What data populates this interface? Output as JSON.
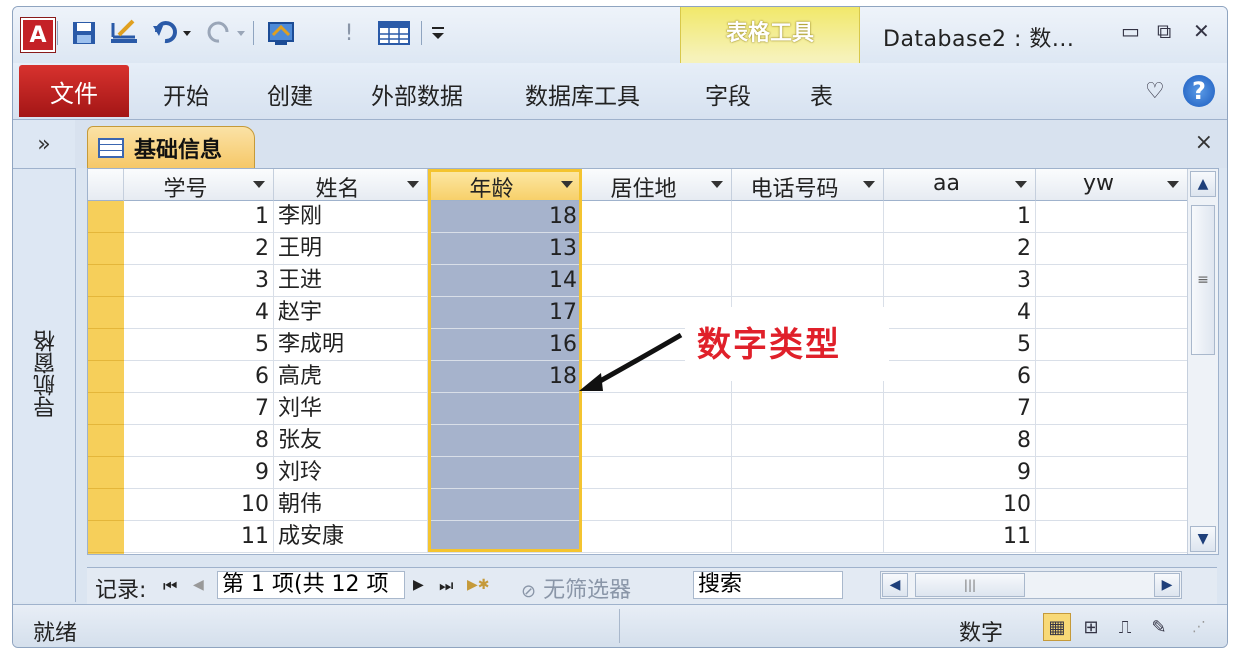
{
  "titlebar": {
    "app_logo": "A",
    "qa_icons": [
      "save-icon",
      "design-icon",
      "undo-icon",
      "redo-icon",
      "view-icon",
      "exclamation-icon",
      "table-icon",
      "customize-icon"
    ],
    "contextual_title": "表格工具",
    "window_title": "Database2 : 数...",
    "minimize": "▭",
    "restore": "⧉",
    "close": "✕"
  },
  "ribbon": {
    "file_tab": "文件",
    "tabs": [
      "开始",
      "创建",
      "外部数据",
      "数据库工具"
    ],
    "contextual_tabs": [
      "字段",
      "表"
    ],
    "help": "?"
  },
  "nav_pane": {
    "toggle": "»",
    "label": "导航窗格"
  },
  "document": {
    "tab_label": "基础信息",
    "close": "×"
  },
  "grid": {
    "columns": [
      "学号",
      "姓名",
      "年龄",
      "居住地",
      "电话号码",
      "aa",
      "yw"
    ],
    "selected_column": "年龄",
    "rows": [
      {
        "id": "1",
        "name": "李刚",
        "age": "18",
        "aa": "1"
      },
      {
        "id": "2",
        "name": "王明",
        "age": "13",
        "aa": "2"
      },
      {
        "id": "3",
        "name": "王进",
        "age": "14",
        "aa": "3"
      },
      {
        "id": "4",
        "name": "赵宇",
        "age": "17",
        "aa": "4"
      },
      {
        "id": "5",
        "name": "李成明",
        "age": "16",
        "aa": "5"
      },
      {
        "id": "6",
        "name": "高虎",
        "age": "18",
        "aa": "6"
      },
      {
        "id": "7",
        "name": "刘华",
        "age": "",
        "aa": "7"
      },
      {
        "id": "8",
        "name": "张友",
        "age": "",
        "aa": "8"
      },
      {
        "id": "9",
        "name": "刘玲",
        "age": "",
        "aa": "9"
      },
      {
        "id": "10",
        "name": "朝伟",
        "age": "",
        "aa": "10"
      },
      {
        "id": "11",
        "name": "成安康",
        "age": "",
        "aa": "11"
      }
    ]
  },
  "annotation": {
    "text": "数字类型",
    "color": "#e0202a"
  },
  "record_nav": {
    "label": "记录:",
    "first": "⏮",
    "prev": "◀",
    "position": "第 1 项(共 12 项",
    "next": "▶",
    "last": "⏭",
    "new": "▶✱",
    "filter": "无筛选器",
    "search": "搜索"
  },
  "statusbar": {
    "left": "就绪",
    "mode": "数字"
  }
}
